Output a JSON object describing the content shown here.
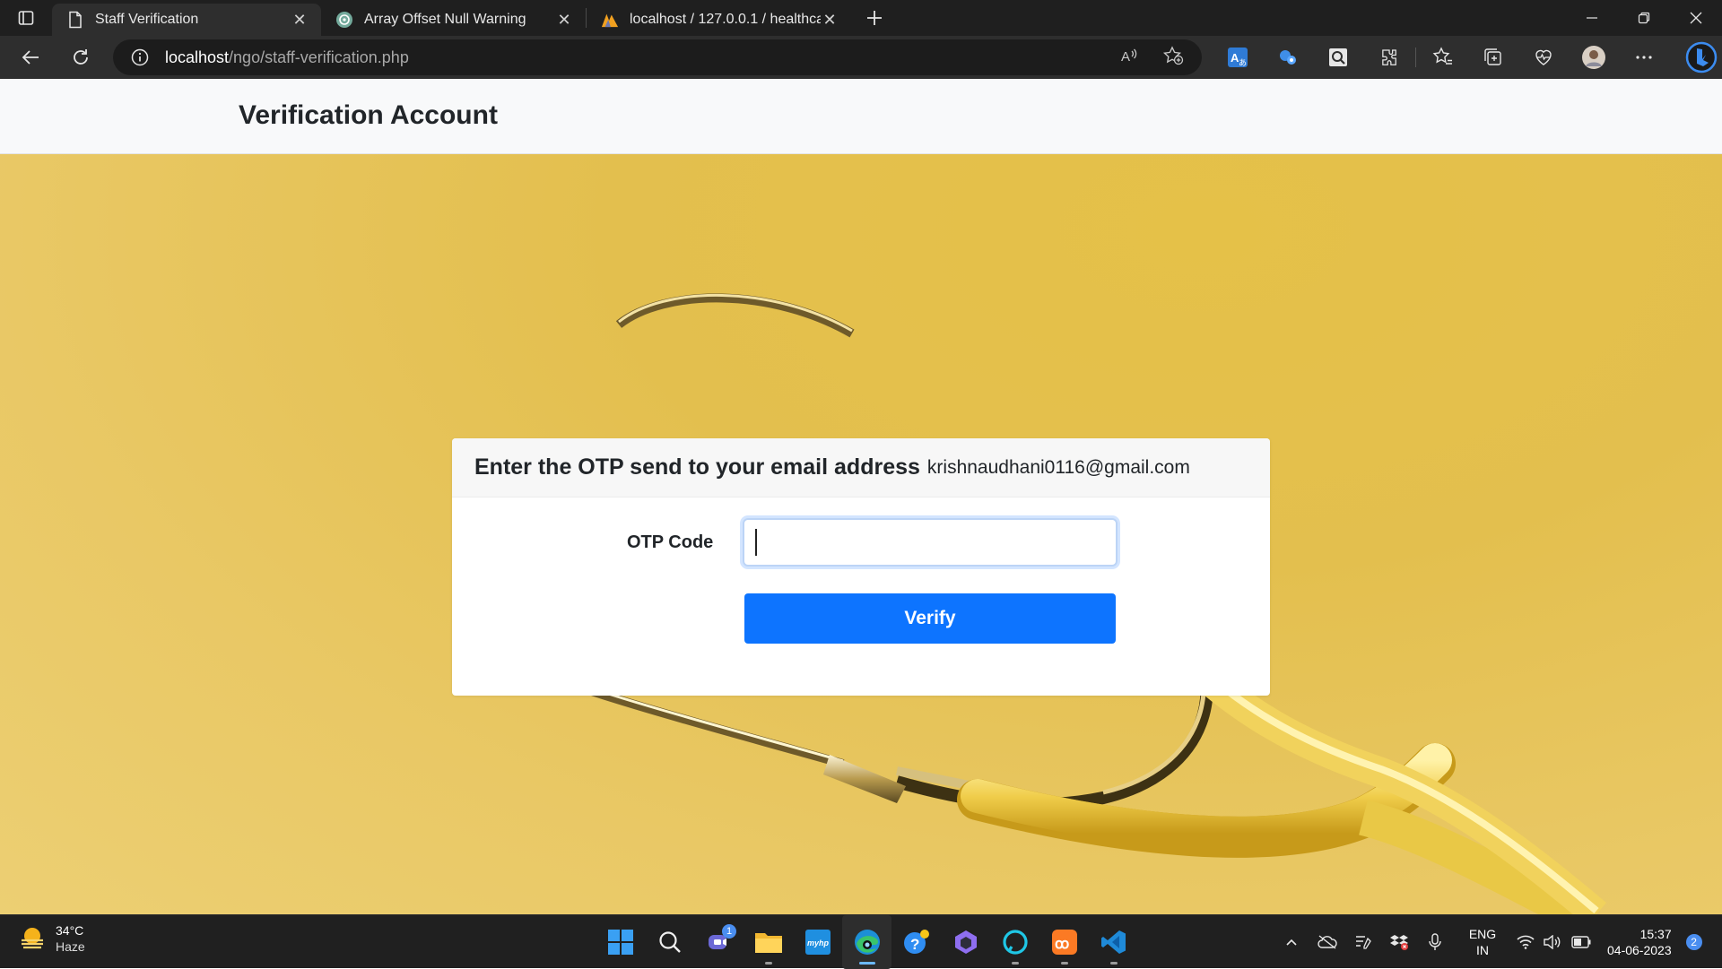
{
  "browser": {
    "tabs": [
      {
        "title": "Staff Verification",
        "active": true
      },
      {
        "title": "Array Offset Null Warning",
        "active": false
      },
      {
        "title": "localhost / 127.0.0.1 / healthcare",
        "active": false
      }
    ],
    "address": {
      "host": "localhost",
      "path": "/ngo/staff-verification.php"
    }
  },
  "page": {
    "site_title": "Verification Account",
    "card": {
      "heading": "Enter the OTP send to your email address",
      "email": "krishnaudhani0116@gmail.com",
      "otp_label": "OTP Code",
      "otp_value": "",
      "verify_label": "Verify"
    }
  },
  "taskbar": {
    "weather": {
      "temperature": "34°C",
      "condition": "Haze"
    },
    "teams_badge": "1",
    "language": {
      "line1": "ENG",
      "line2": "IN"
    },
    "time": "15:37",
    "date": "04-06-2023",
    "notifications": "2"
  },
  "colors": {
    "accent": "#0d74ff",
    "hero_background": "#e3bf4e",
    "chrome": "#1f1f1f"
  }
}
